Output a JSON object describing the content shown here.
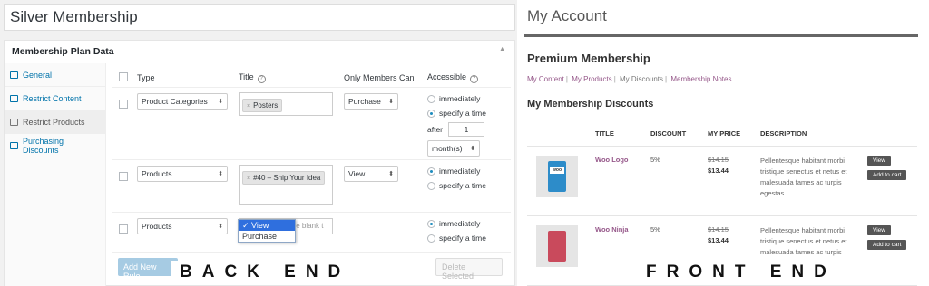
{
  "backend": {
    "plan_title": "Silver Membership",
    "panel_title": "Membership Plan Data",
    "tabs": [
      {
        "label": "General"
      },
      {
        "label": "Restrict Content"
      },
      {
        "label": "Restrict Products"
      },
      {
        "label": "Purchasing Discounts"
      }
    ],
    "columns": {
      "type": "Type",
      "title": "Title",
      "members": "Only Members Can",
      "accessible": "Accessible"
    },
    "rules": [
      {
        "type": "Product Categories",
        "tag": "Posters",
        "members": "Purchase",
        "immediately": "immediately",
        "specify": "specify a time",
        "after": "after",
        "after_value": "1",
        "unit": "month(s)"
      },
      {
        "type": "Products",
        "tag": "#40 – Ship Your Idea",
        "members": "View",
        "immediately": "immediately",
        "specify": "specify a time"
      },
      {
        "type": "Products",
        "search_placeholder": "Search... or leave blank t",
        "members": "View",
        "immediately": "immediately",
        "specify": "specify a time"
      }
    ],
    "dropdown_options": [
      "✓ View",
      "Purchase"
    ],
    "add_button": "Add New Rule",
    "delete_button": "Delete Selected"
  },
  "captions": {
    "back": "BACK END",
    "front": "FRONT END"
  },
  "frontend": {
    "account_title": "My Account",
    "membership_title": "Premium Membership",
    "nav": [
      "My Content",
      "My Products",
      "My Discounts",
      "Membership Notes"
    ],
    "discounts_title": "My Membership Discounts",
    "columns": [
      "TITLE",
      "DISCOUNT",
      "MY PRICE",
      "DESCRIPTION"
    ],
    "products": [
      {
        "title": "Woo Logo",
        "discount": "5%",
        "old_price": "$14.15",
        "new_price": "$13.44",
        "description": "Pellentesque habitant morbi tristique senectus et netus et malesuada fames ac turpis egestas. ...",
        "view": "View",
        "cart": "Add to cart",
        "color": "#2d8cc9",
        "logo": "woo"
      },
      {
        "title": "Woo Ninja",
        "discount": "5%",
        "old_price": "$14.15",
        "new_price": "$13.44",
        "description": "Pellentesque habitant morbi tristique senectus et netus et malesuada fames ac turpis egestas.",
        "view": "View",
        "cart": "Add to cart",
        "color": "#c94a5c",
        "logo": ""
      }
    ]
  },
  "colors": {
    "link": "#0073aa",
    "accent": "#96588a",
    "highlight": "#2f6fde"
  }
}
